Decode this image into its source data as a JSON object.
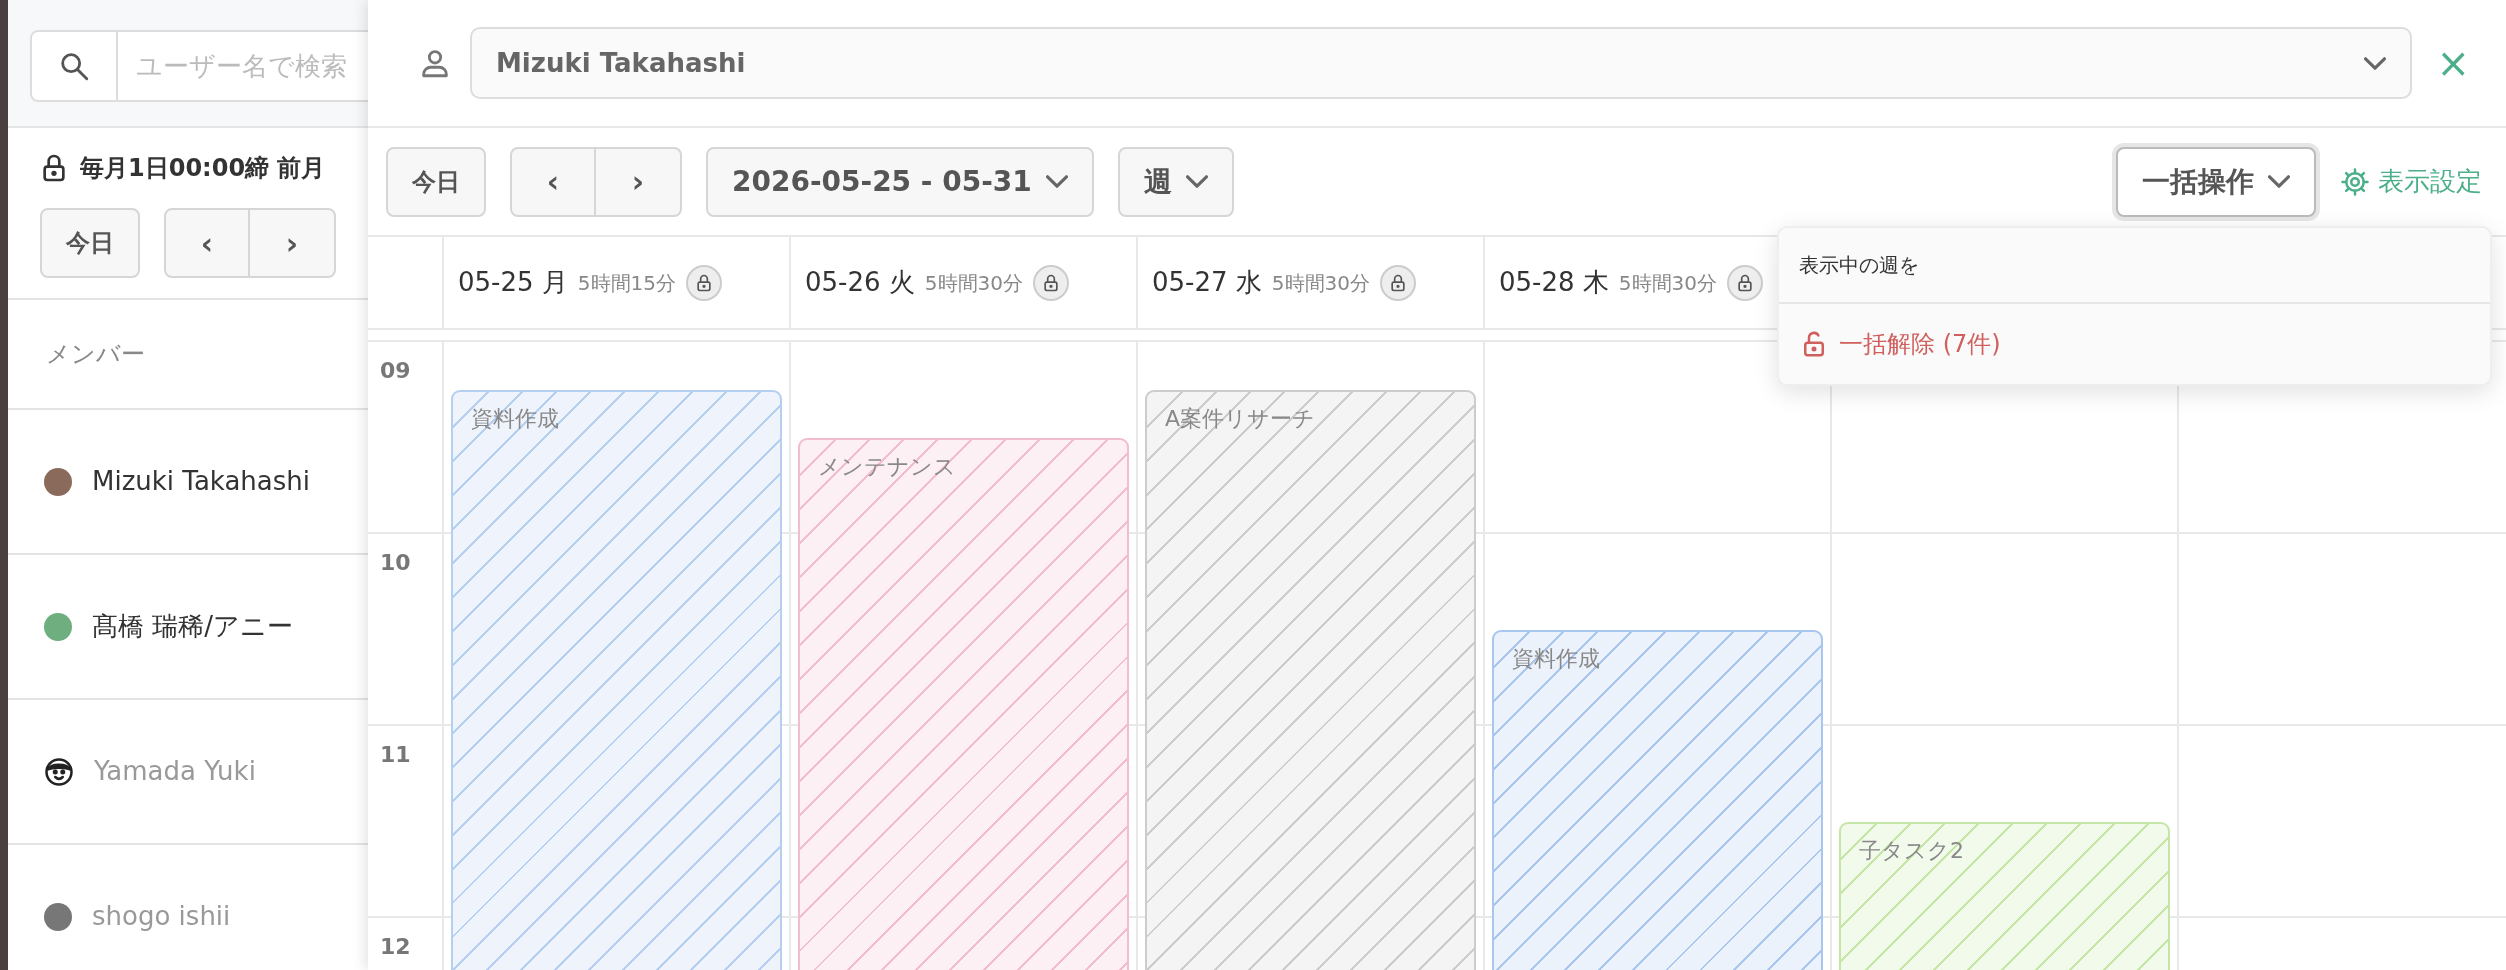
{
  "sidebar": {
    "search": {
      "placeholder": "ユーザー名で検索"
    },
    "closing_note": "毎月1日00:00締 前月",
    "toolbar": {
      "today": "今日",
      "prev": "‹",
      "next": "›"
    },
    "members_header": "メンバー",
    "members": [
      {
        "name": "Mizuki Takahashi",
        "kind": "photo",
        "color": "#8a6a5a",
        "active": true
      },
      {
        "name": "髙橋 瑞稀/アニー",
        "kind": "photo",
        "color": "#6fae7f",
        "active": true
      },
      {
        "name": "Yamada Yuki",
        "kind": "default",
        "color": "#222222",
        "active": false
      },
      {
        "name": "shogo ishii",
        "kind": "photo",
        "color": "#777777",
        "active": false
      }
    ]
  },
  "drawer": {
    "user_select": {
      "value": "Mizuki Takahashi"
    },
    "close": "×",
    "toolbar": {
      "today": "今日",
      "prev": "‹",
      "next": "›",
      "date_range": "2026-05-25 - 05-31",
      "view": "週",
      "bulk": {
        "label": "一括操作",
        "expanded": true
      },
      "settings": "表示設定"
    },
    "bulk_menu": {
      "header": "表示中の週を",
      "items": [
        {
          "label": "一括解除 (7件)"
        }
      ]
    },
    "hours": [
      "09",
      "10",
      "11",
      "12"
    ],
    "days": [
      {
        "date": "05-25",
        "weekday": "月",
        "total": "5時間15分",
        "events": [
          {
            "title": "資料作成",
            "color": "#b4cff0"
          }
        ]
      },
      {
        "date": "05-26",
        "weekday": "火",
        "total": "5時間30分",
        "events": [
          {
            "title": "メンテナンス",
            "color": "#f2bdd0"
          }
        ]
      },
      {
        "date": "05-27",
        "weekday": "水",
        "total": "5時間30分",
        "events": [
          {
            "title": "A案件リサーチ",
            "color": "#cccccc"
          }
        ]
      },
      {
        "date": "05-28",
        "weekday": "木",
        "total": "5時間30分",
        "events": [
          {
            "title": "資料作成",
            "color": "#a9c6ee"
          }
        ]
      },
      {
        "events": [
          {
            "title": "子タスク2",
            "color": "#c6e6a8"
          }
        ]
      }
    ]
  }
}
